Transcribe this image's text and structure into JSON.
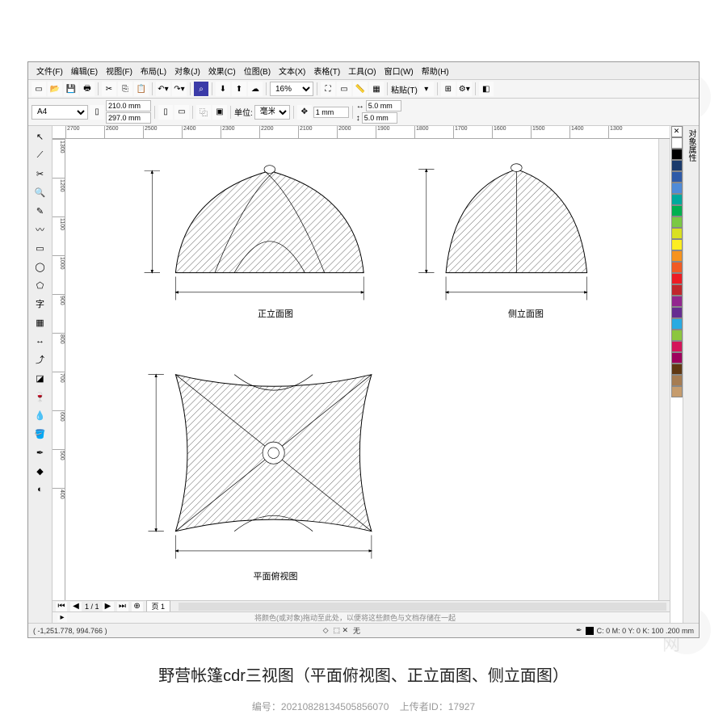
{
  "menu": {
    "file": "文件(F)",
    "edit": "编辑(E)",
    "view": "视图(F)",
    "layout": "布局(L)",
    "object": "对象(J)",
    "effect": "效果(C)",
    "bitmap": "位图(B)",
    "text": "文本(X)",
    "table": "表格(T)",
    "tools": "工具(O)",
    "window": "窗口(W)",
    "help": "帮助(H)"
  },
  "toolbar": {
    "zoom": "16%",
    "paste": "粘贴(T)"
  },
  "property": {
    "page": "A4",
    "width": "210.0 mm",
    "height": "297.0 mm",
    "unit_label": "单位:",
    "unit": "毫米",
    "nudge": "1 mm",
    "dup_x": "5.0 mm",
    "dup_y": "5.0 mm"
  },
  "ruler_h": [
    "2700",
    "2600",
    "2500",
    "2400",
    "2300",
    "2200",
    "2100",
    "2000",
    "1900",
    "1800",
    "1700",
    "1600",
    "1500",
    "1400",
    "1300"
  ],
  "ruler_v": [
    "1300",
    "1200",
    "1100",
    "1000",
    "900",
    "800",
    "700",
    "600",
    "500",
    "400"
  ],
  "labels": {
    "front": "正立面图",
    "side": "侧立面图",
    "top": "平面俯视图",
    "dim_placeholder": "—"
  },
  "page_tabs": {
    "nav": "1 / 1",
    "page1": "页 1"
  },
  "hint": "将颜色(或对象)拖动至此处，以便将这些颜色与文档存储在一起",
  "status": {
    "coords": "( -1,251.778, 994.766 )",
    "fill_none": "无",
    "color_readout": "C: 0 M: 0 Y: 0 K: 100   .200 mm"
  },
  "right_panel": "对象属性",
  "palette": [
    "#ffffff",
    "#000000",
    "#1b3a6b",
    "#2e5aa8",
    "#4f8bd8",
    "#00a99d",
    "#00b050",
    "#7ac943",
    "#d9e021",
    "#fcee21",
    "#f7931e",
    "#f15a24",
    "#ed1c24",
    "#c1272d",
    "#93278f",
    "#662d91",
    "#29abe2",
    "#8cc63f",
    "#d4145a",
    "#9e005d",
    "#603813",
    "#a67c52",
    "#c69c6d"
  ],
  "caption": "野营帐篷cdr三视图（平面俯视图、正立面图、侧立面图）",
  "meta": {
    "id_label": "编号：",
    "id": "2021082813450585​6070",
    "uploader_label": "上传者ID：",
    "uploader": "17927"
  },
  "watermark": "汇图网"
}
